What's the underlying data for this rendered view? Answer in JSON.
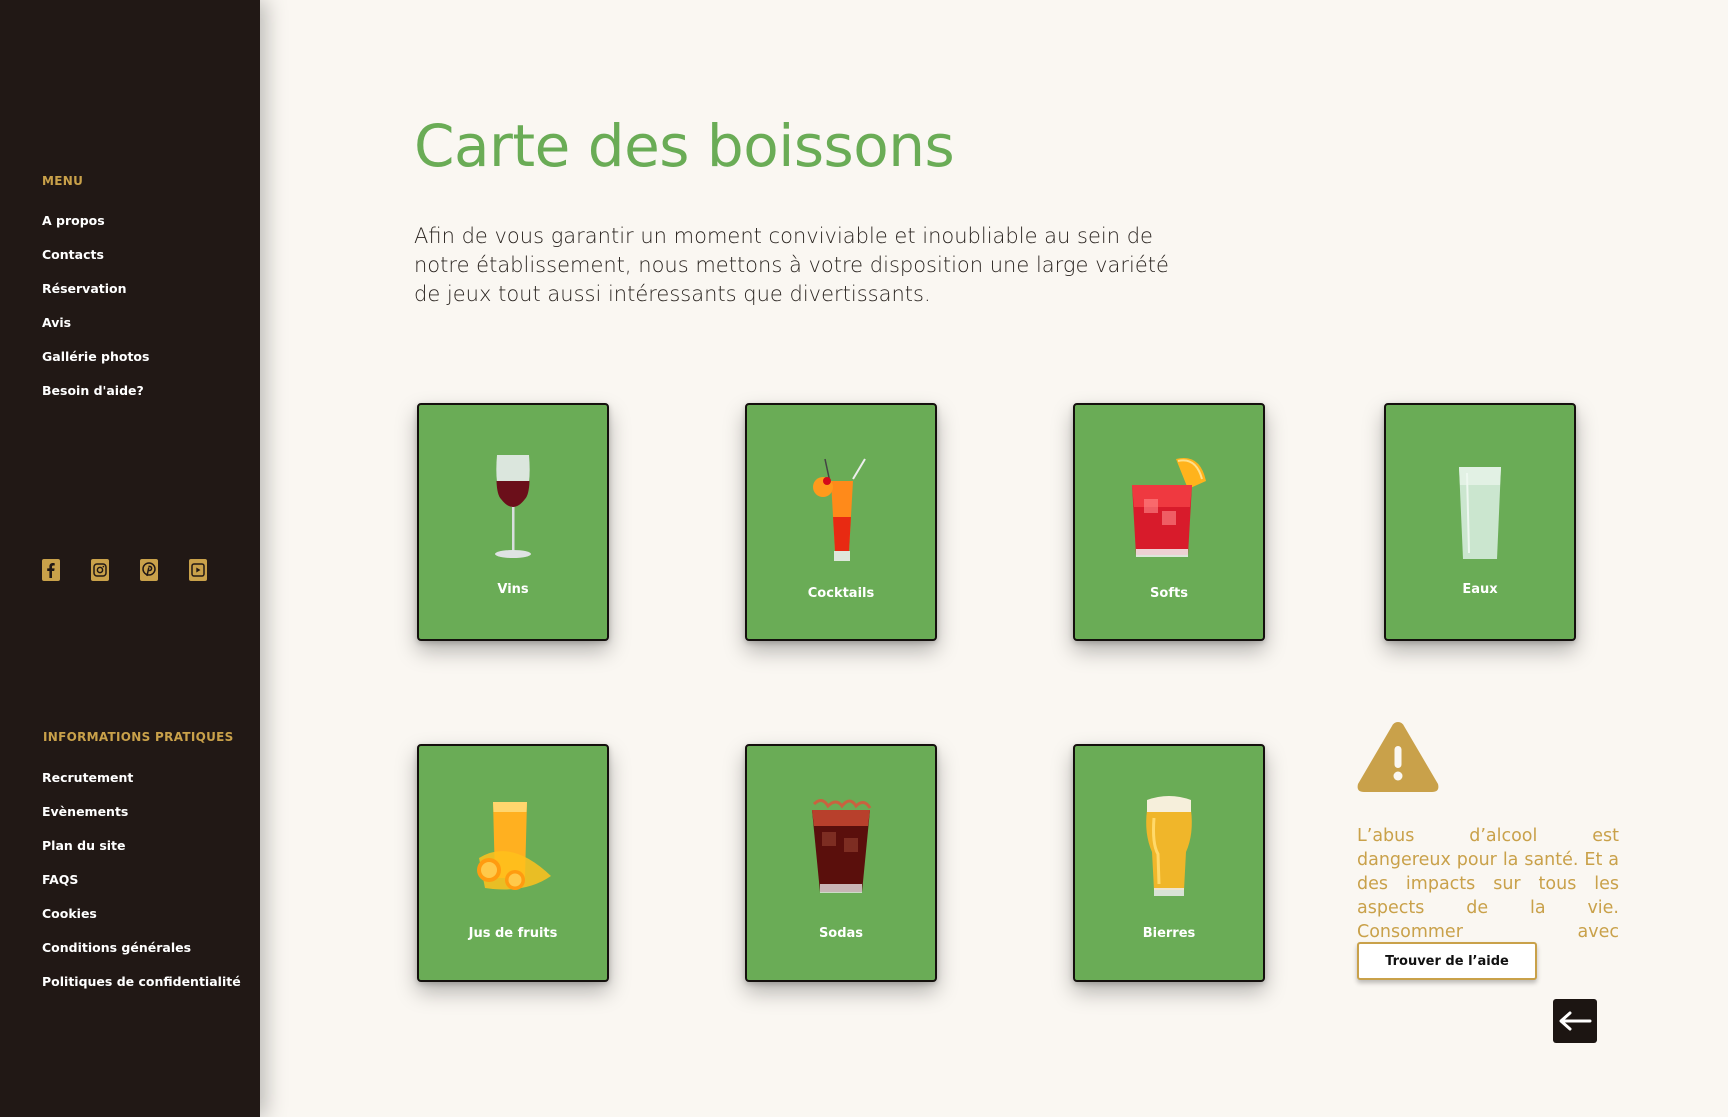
{
  "sidebar": {
    "menu_heading": "MENU",
    "menu_items": [
      "A propos",
      "Contacts",
      "Réservation",
      "Avis",
      "Gallérie photos",
      "Besoin d'aide?"
    ],
    "social_icons": [
      "facebook-icon",
      "instagram-icon",
      "pinterest-icon",
      "youtube-icon"
    ],
    "info_heading": "INFORMATIONS PRATIQUES",
    "info_items": [
      "Recrutement",
      "Evènements",
      "Plan du site",
      "FAQS",
      "Cookies",
      "Conditions générales",
      "Politiques de confidentialité"
    ]
  },
  "main": {
    "title": "Carte des boissons",
    "intro": "Afin de vous garantir un moment conviviable et inoubliable au sein de notre établissement, nous mettons à votre disposition une large variété de jeux tout aussi intéressants que divertissants.",
    "categories": [
      {
        "label": "Vins",
        "icon": "wine-glass-icon"
      },
      {
        "label": "Cocktails",
        "icon": "cocktail-icon"
      },
      {
        "label": "Softs",
        "icon": "soft-drink-icon"
      },
      {
        "label": "Eaux",
        "icon": "water-glass-icon"
      },
      {
        "label": "Jus de fruits",
        "icon": "orange-juice-icon"
      },
      {
        "label": "Sodas",
        "icon": "soda-icon"
      },
      {
        "label": "Bierres",
        "icon": "beer-icon"
      }
    ]
  },
  "warning": {
    "icon": "warning-icon",
    "text": "L’abus d’alcool est dangereux pour la santé. Et a des impacts sur tous les aspects de la vie. Consommer avec modération.",
    "button_label": "Trouver de l’aide"
  },
  "back_button": {
    "icon": "arrow-left-icon"
  },
  "colors": {
    "sidebar_bg": "#211815",
    "accent_gold": "#c9a14a",
    "card_green": "#6aac56",
    "page_bg": "#faf7f2"
  }
}
